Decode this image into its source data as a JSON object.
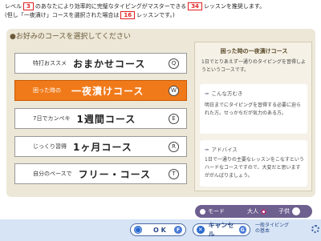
{
  "info": {
    "line1_pre": "レベル",
    "level": "3",
    "line1_mid": "のあなたにより効率的に完璧なタイピングがマスターできる",
    "lessons": "34",
    "line1_post": "レッスンを推奨します。",
    "line2_pre": "(但し「一夜漬け」コースを選択された場合は",
    "lessons_ichiya": "16",
    "line2_post": "レッスンです。)"
  },
  "heading": "●お好みのコースを選択してください",
  "courses": [
    {
      "sub": "特打おススメ",
      "main": "おまかせコース",
      "key": "Q"
    },
    {
      "sub": "困った時の",
      "main": "一夜漬けコース",
      "key": "W"
    },
    {
      "sub": "7日でカンペキ",
      "main": "1週間コース",
      "key": "E"
    },
    {
      "sub": "じっくり習得",
      "main": "1ヶ月コース",
      "key": "R"
    },
    {
      "sub": "自分のペースで",
      "main": "フリー・コース",
      "key": "T"
    }
  ],
  "selected_course_index": 1,
  "detail": {
    "title": "困った時の一夜漬けコース",
    "description": "1日でとりあえず一通りのタイピングを習得しようというコースです。",
    "section1_label": "こんな方むき",
    "section1_text": "明日までにタイピングを習得する必要に迫られた方。せっかちだが気力のある方。",
    "section2_label": "アドバイス",
    "section2_text": "1日で一通りの主要なレッスンをこなすというハードなコースですので、大変だと思いますががんばりましょう。"
  },
  "mode": {
    "label": "モード",
    "option_adult": "大人",
    "option_child": "子供",
    "selected": "大人"
  },
  "buttons": {
    "ok_label": "O K",
    "ok_key": "F",
    "cancel_label": "キャンセル",
    "cancel_key": "G",
    "typing_link_line1": "一般タイピング",
    "typing_link_line2": "の基本"
  },
  "colors": {
    "selected_course": "#f07a1a",
    "panel_bg": "#ece7d7",
    "mode_bar": "#6d5f8e",
    "accent_red": "#e02020"
  }
}
